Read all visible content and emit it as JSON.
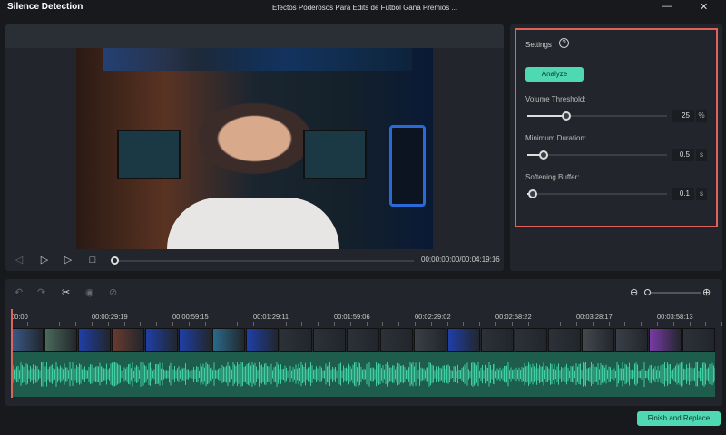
{
  "titlebar": {
    "app_title": "Silence Detection",
    "document_title": "Efectos Poderosos Para Edits de Fútbol   Gana Premios ...",
    "minimize": "—",
    "close": "✕"
  },
  "player": {
    "timecode": "00:00:00:00/00:04:19:16",
    "progress": 0
  },
  "settings": {
    "label": "Settings",
    "help": "?",
    "analyze": "Analyze",
    "sliders": [
      {
        "label": "Volume Threshold:",
        "value": "25",
        "unit": "%",
        "fraction": 0.28
      },
      {
        "label": "Minimum Duration:",
        "value": "0.5",
        "unit": "s",
        "fraction": 0.12
      },
      {
        "label": "Softening Buffer:",
        "value": "0.1",
        "unit": "s",
        "fraction": 0.04
      }
    ]
  },
  "timeline": {
    "ruler": [
      "00:00",
      "00:00:29:19",
      "00:00:59:15",
      "00:01:29:11",
      "00:01:59:06",
      "00:02:29:02",
      "00:02:58:22",
      "00:03:28:17",
      "00:03:58:13"
    ],
    "zoom": 0
  },
  "footer": {
    "finish": "Finish and Replace"
  },
  "colors": {
    "accent": "#4fd8b4",
    "highlight": "#e0625c",
    "waveform": "#3fcfa0"
  }
}
